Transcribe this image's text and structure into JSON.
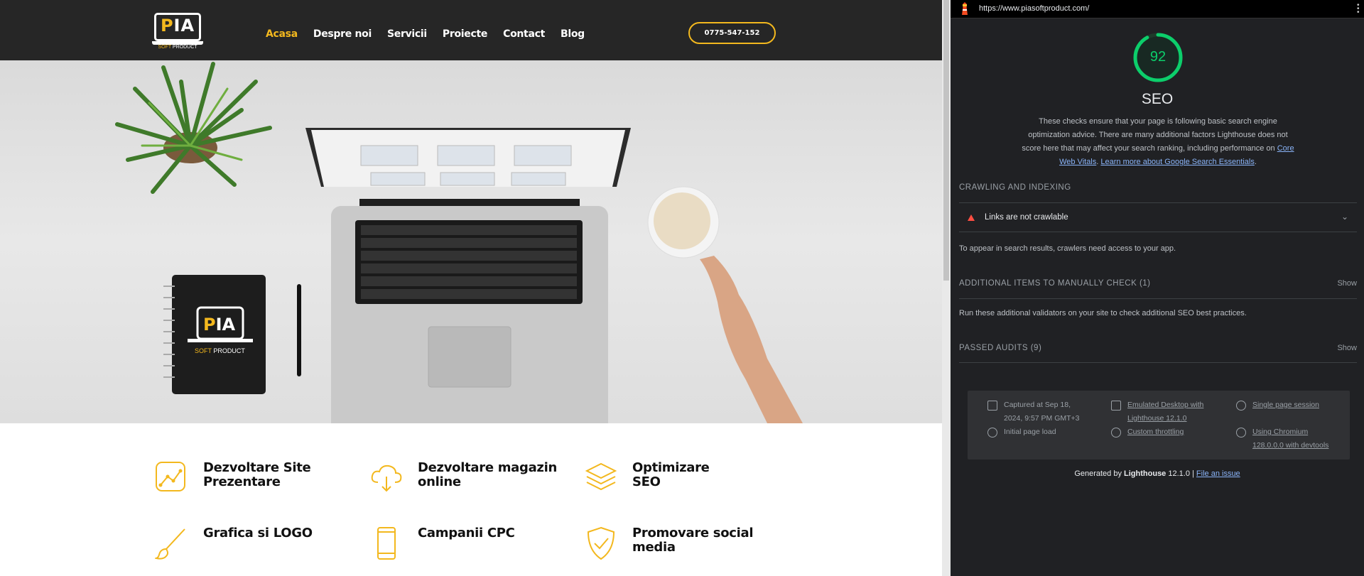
{
  "site": {
    "logo": {
      "text_p": "P",
      "text_rest": "IA",
      "sub_soft": "SOFT",
      "sub_product": " PRODUCT"
    },
    "nav": [
      {
        "label": "Acasa",
        "active": true
      },
      {
        "label": "Despre noi"
      },
      {
        "label": "Servicii"
      },
      {
        "label": "Proiecte"
      },
      {
        "label": "Contact"
      },
      {
        "label": "Blog"
      }
    ],
    "phone": "0775-547-152",
    "services": [
      {
        "title": "Dezvoltare Site Prezentare",
        "icon": "chart-icon"
      },
      {
        "title": "Dezvoltare magazin online",
        "icon": "cloud-download-icon"
      },
      {
        "title": "Optimizare SEO",
        "icon": "layers-icon"
      },
      {
        "title": "Grafica si LOGO",
        "icon": "brush-icon"
      },
      {
        "title": "Campanii CPC",
        "icon": "phone-icon"
      },
      {
        "title": "Promovare social media",
        "icon": "shield-check-icon"
      }
    ],
    "accent": "#f3b81e"
  },
  "devtools": {
    "url": "https://www.piasoftproduct.com/",
    "score": 92,
    "score_fraction": 0.92,
    "category": "SEO",
    "desc_pre": "These checks ensure that your page is following basic search engine optimization advice. There are many additional factors Lighthouse does not score here that may affect your search ranking, including performance on ",
    "desc_link1": "Core Web Vitals",
    "desc_sep": ". ",
    "desc_link2": "Learn more about Google Search Essentials",
    "desc_end": ".",
    "crawling_head": "CRAWLING AND INDEXING",
    "audit_fail": "Links are not crawlable",
    "crawl_note": "To appear in search results, crawlers need access to your app.",
    "manual_head": "ADDITIONAL ITEMS TO MANUALLY CHECK (1)",
    "manual_show": "Show",
    "manual_note": "Run these additional validators on your site to check additional SEO best practices.",
    "passed_head": "PASSED AUDITS (9)",
    "passed_show": "Show",
    "env": {
      "captured_1": "Captured at Sep 18,",
      "captured_2": "2024, 9:57 PM GMT+3",
      "load": "Initial page load",
      "device_1": "Emulated Desktop with",
      "device_2": "Lighthouse 12.1.0",
      "throttle": "Custom throttling",
      "session": "Single page session",
      "browser_1": "Using Chromium",
      "browser_2": "128.0.0.0 with devtools"
    },
    "gen_pre": "Generated by ",
    "gen_lh": "Lighthouse",
    "gen_ver": " 12.1.0 | ",
    "gen_issue": "File an issue",
    "score_color": "#0cce6b",
    "fail_color": "#ff4e42"
  }
}
